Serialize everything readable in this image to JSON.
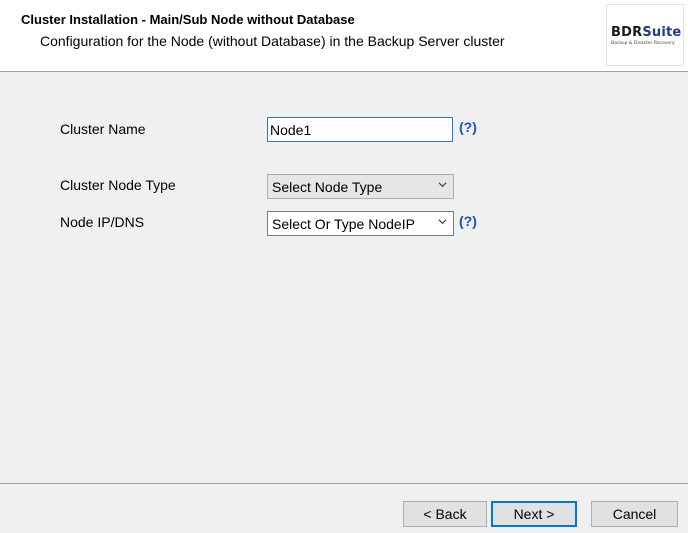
{
  "header": {
    "title": "Cluster Installation - Main/Sub Node without Database",
    "subtitle": "Configuration for the Node (without Database) in the Backup Server cluster",
    "logo_text_part1": "BDR",
    "logo_text_part2": "Suite",
    "logo_tagline": "Backup & Disaster Recovery"
  },
  "form": {
    "cluster_name_label": "Cluster Name",
    "cluster_name_value": "Node1",
    "cluster_node_type_label": "Cluster Node Type",
    "cluster_node_type_value": "Select Node Type",
    "node_ip_label": "Node IP/DNS",
    "node_ip_value": "Select Or Type NodeIP",
    "help_text": "(?)"
  },
  "buttons": {
    "back": "< Back",
    "next": "Next >",
    "cancel": "Cancel"
  },
  "colors": {
    "help_link": "#1d4fc0",
    "focus_border": "#0078d7",
    "background": "#f0f0f0"
  },
  "icons": {
    "dropdown": "chevron-down-icon"
  }
}
